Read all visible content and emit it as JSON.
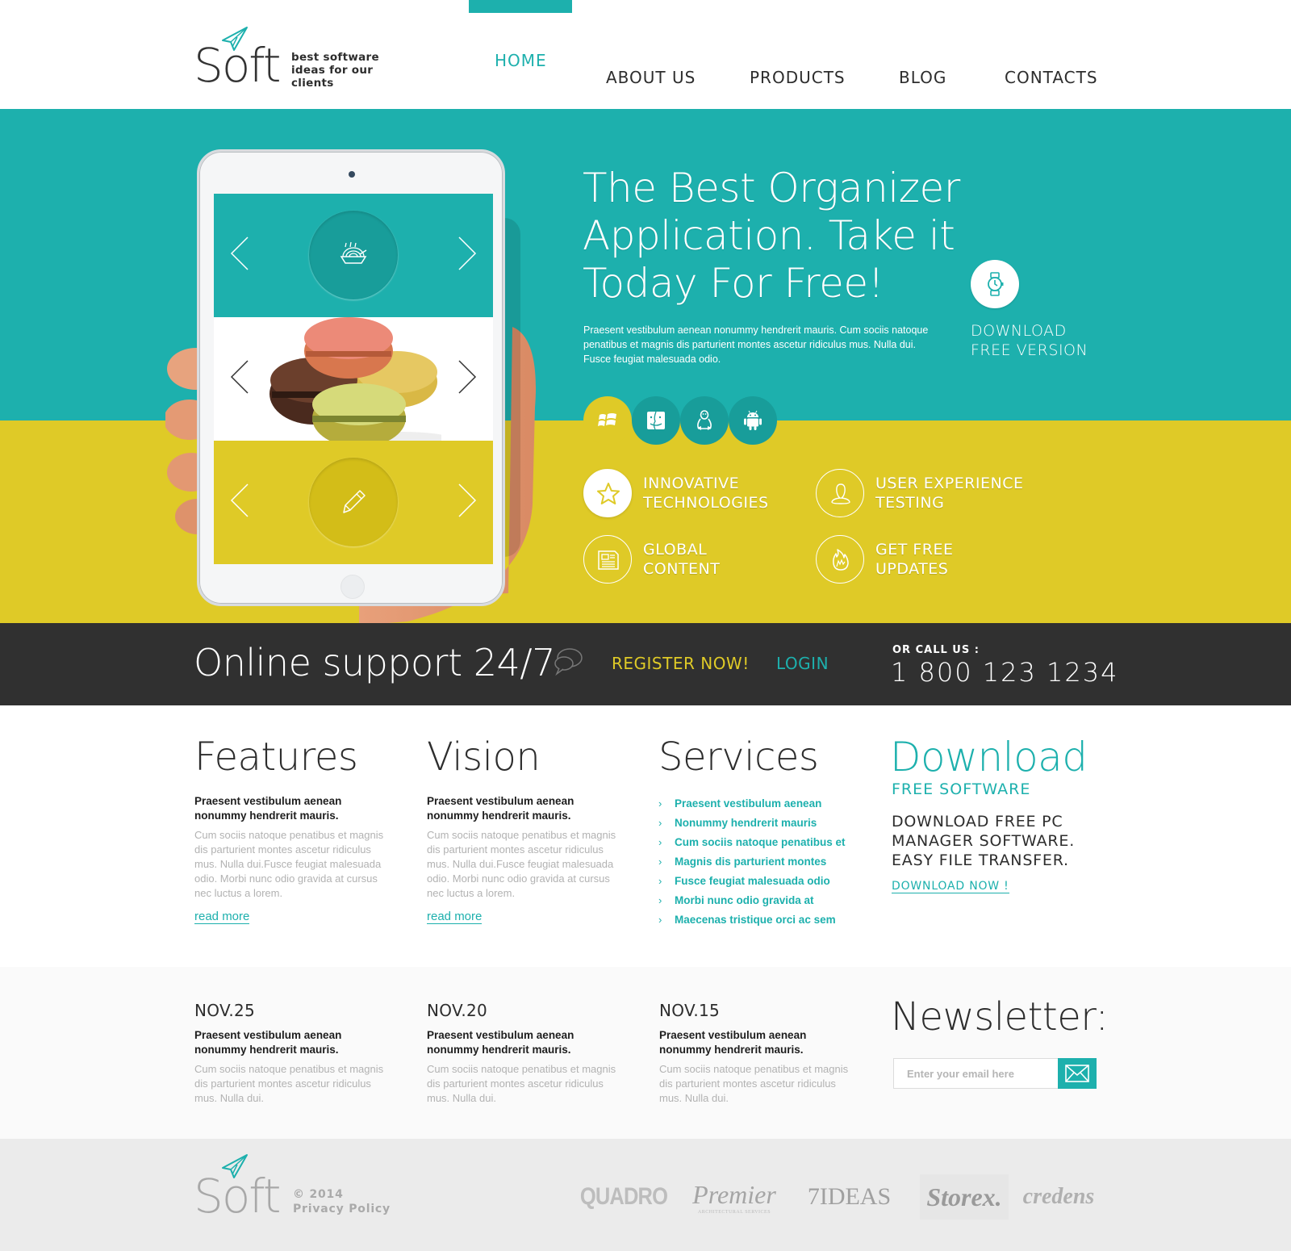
{
  "brand": {
    "name": "Soft",
    "tagline": "best software ideas for our clients"
  },
  "nav": {
    "items": [
      {
        "label": "HOME",
        "active": true
      },
      {
        "label": "ABOUT US",
        "active": false
      },
      {
        "label": "PRODUCTS",
        "active": false
      },
      {
        "label": "BLOG",
        "active": false
      },
      {
        "label": "CONTACTS",
        "active": false
      }
    ]
  },
  "hero": {
    "title": "The Best Organizer Application. Take it Today For Free!",
    "text": "Praesent vestibulum aenean nonummy hendrerit mauris. Cum sociis natoque penatibus et magnis dis parturient montes ascetur ridiculus mus. Nulla dui. Fusce feugiat malesuada odio.",
    "download": {
      "label_line1": "DOWNLOAD",
      "label_line2": "FREE VERSION",
      "icon": "watch-icon"
    },
    "slider_panels": [
      {
        "icon": "food-bowl-icon",
        "color": "#1db0ad"
      },
      {
        "icon": "macarons-photo",
        "color": "#ffffff"
      },
      {
        "icon": "pencil-icon",
        "color": "#dfca27"
      }
    ],
    "platforms": [
      {
        "name": "windows",
        "icon": "windows-icon",
        "active": true
      },
      {
        "name": "mac",
        "icon": "finder-icon",
        "active": false
      },
      {
        "name": "linux",
        "icon": "linux-penguin-icon",
        "active": false
      },
      {
        "name": "android",
        "icon": "android-icon",
        "active": false
      }
    ],
    "features": [
      {
        "line1": "INNOVATIVE",
        "line2": "TECHNOLOGIES",
        "icon": "star-icon"
      },
      {
        "line1": "USER EXPERIENCE",
        "line2": "TESTING",
        "icon": "user-icon"
      },
      {
        "line1": "GLOBAL",
        "line2": "CONTENT",
        "icon": "newspaper-icon"
      },
      {
        "line1": "GET FREE",
        "line2": "UPDATES",
        "icon": "flame-icon"
      }
    ]
  },
  "support": {
    "title": "Online support 24/7",
    "register": "REGISTER NOW!",
    "login": "LOGIN",
    "call_label": "OR CALL US :",
    "phone": "1 800 123 1234"
  },
  "info": {
    "features": {
      "title": "Features",
      "lead": "Praesent vestibulum aenean nonummy hendrerit mauris.",
      "body": "Cum sociis natoque penatibus et magnis dis parturient montes ascetur ridiculus mus. Nulla dui.Fusce feugiat malesuada odio. Morbi nunc odio gravida at cursus nec luctus a lorem.",
      "link": "read more"
    },
    "vision": {
      "title": "Vision",
      "lead": "Praesent vestibulum aenean nonummy hendrerit mauris.",
      "body": "Cum sociis natoque penatibus et magnis dis parturient montes ascetur ridiculus mus. Nulla dui.Fusce feugiat malesuada odio. Morbi nunc odio gravida at cursus nec luctus a lorem.",
      "link": "read more"
    },
    "services": {
      "title": "Services",
      "items": [
        "Praesent vestibulum aenean",
        "Nonummy hendrerit mauris",
        "Cum sociis natoque penatibus et",
        "Magnis dis parturient montes",
        "Fusce feugiat malesuada odio",
        "Morbi nunc odio gravida at",
        "Maecenas tristique orci ac sem"
      ]
    },
    "download": {
      "title": "Download",
      "subtitle": "FREE SOFTWARE",
      "desc": "DOWNLOAD FREE PC MANAGER SOFTWARE. EASY FILE TRANSFER.",
      "link": "DOWNLOAD NOW !"
    }
  },
  "news": [
    {
      "date": "NOV.25",
      "lead": "Praesent vestibulum aenean nonummy hendrerit mauris.",
      "body": "Cum sociis natoque penatibus et magnis dis parturient montes ascetur ridiculus mus. Nulla dui."
    },
    {
      "date": "NOV.20",
      "lead": "Praesent vestibulum aenean nonummy hendrerit mauris.",
      "body": "Cum sociis natoque penatibus et magnis dis parturient montes ascetur ridiculus mus. Nulla dui."
    },
    {
      "date": "NOV.15",
      "lead": "Praesent vestibulum aenean nonummy hendrerit mauris.",
      "body": "Cum sociis natoque penatibus et magnis dis parturient montes ascetur ridiculus mus. Nulla dui."
    }
  ],
  "newsletter": {
    "title": "Newsletter:",
    "placeholder": "Enter your email here",
    "value": ""
  },
  "footer": {
    "brand": "Soft",
    "copyright": "© 2014",
    "privacy": "Privacy Policy",
    "partners": [
      {
        "name": "QUADRO"
      },
      {
        "name": "Premier",
        "sub": "ARCHITECTURAL SERVICES"
      },
      {
        "name": "7IDEAS"
      },
      {
        "name": "Storex."
      },
      {
        "name": "credens"
      }
    ]
  },
  "colors": {
    "teal": "#1db0ad",
    "teal_dark": "#189d9a",
    "yellow": "#dfca27",
    "dark_bar": "#303030",
    "text": "#2d2d2d",
    "muted": "#b2b2b2",
    "footer_bg": "#ebebeb"
  }
}
